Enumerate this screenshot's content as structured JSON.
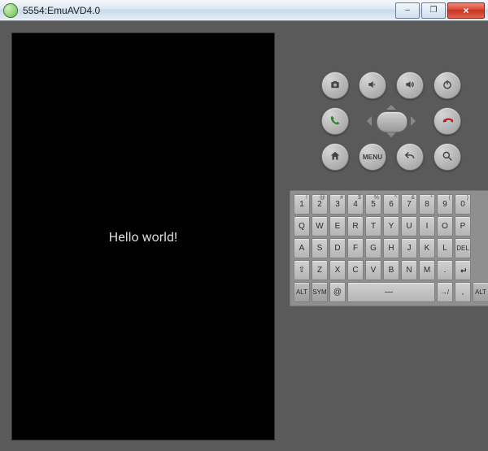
{
  "window": {
    "title": "5554:EmuAVD4.0",
    "minimize": "–",
    "maximize": "❐",
    "close": "×"
  },
  "screen": {
    "message": "Hello world!"
  },
  "hw_buttons": {
    "camera": "camera",
    "vol_down": "volume down",
    "vol_up": "volume up",
    "power": "power",
    "call": "call",
    "end_call": "end call",
    "home": "home",
    "menu_label": "MENU",
    "back": "back",
    "search": "search"
  },
  "keyboard": {
    "row1": [
      {
        "main": "1",
        "sec": "!"
      },
      {
        "main": "2",
        "sec": "@"
      },
      {
        "main": "3",
        "sec": "#"
      },
      {
        "main": "4",
        "sec": "$"
      },
      {
        "main": "5",
        "sec": "%"
      },
      {
        "main": "6",
        "sec": "^"
      },
      {
        "main": "7",
        "sec": "&"
      },
      {
        "main": "8",
        "sec": "*"
      },
      {
        "main": "9",
        "sec": "("
      },
      {
        "main": "0",
        "sec": ")"
      }
    ],
    "row2": [
      {
        "main": "Q"
      },
      {
        "main": "W"
      },
      {
        "main": "E"
      },
      {
        "main": "R"
      },
      {
        "main": "T"
      },
      {
        "main": "Y"
      },
      {
        "main": "U"
      },
      {
        "main": "I"
      },
      {
        "main": "O"
      },
      {
        "main": "P"
      }
    ],
    "row3": [
      {
        "main": "A"
      },
      {
        "main": "S"
      },
      {
        "main": "D"
      },
      {
        "main": "F"
      },
      {
        "main": "G"
      },
      {
        "main": "H"
      },
      {
        "main": "J"
      },
      {
        "main": "K"
      },
      {
        "main": "L"
      }
    ],
    "row3_del": "DEL",
    "row4": [
      {
        "main": "⇧"
      },
      {
        "main": "Z"
      },
      {
        "main": "X"
      },
      {
        "main": "C"
      },
      {
        "main": "V"
      },
      {
        "main": "B"
      },
      {
        "main": "N"
      },
      {
        "main": "M"
      },
      {
        "main": "."
      },
      {
        "main": "↵"
      }
    ],
    "row5_alt": "ALT",
    "row5_sym": "SYM",
    "row5_at": "@",
    "row5_space": "—",
    "row5_slash": "/",
    "row5_comma": ",",
    "row5_alt2": "ALT"
  }
}
